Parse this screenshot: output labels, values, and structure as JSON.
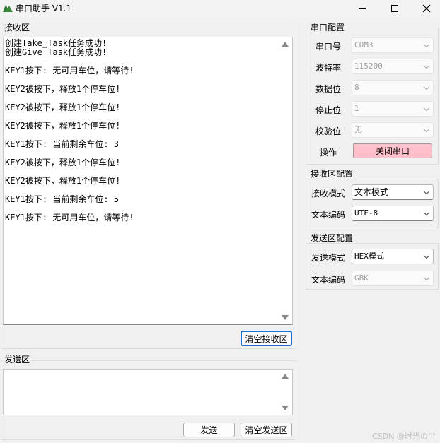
{
  "window": {
    "title": "串口助手 V1.1"
  },
  "receive": {
    "group_title": "接收区",
    "lines": [
      "创建Take_Task任务成功!",
      "创建Give_Task任务成功!",
      "",
      "KEY1按下: 无可用车位，请等待!",
      "",
      "KEY2被按下，释放1个停车位!",
      "",
      "KEY2被按下，释放1个停车位!",
      "",
      "KEY2被按下，释放1个停车位!",
      "",
      "KEY1按下: 当前剩余车位: 3",
      "",
      "KEY2被按下，释放1个停车位!",
      "",
      "KEY2被按下，释放1个停车位!",
      "",
      "KEY1按下: 当前剩余车位: 5",
      "",
      "KEY1按下: 无可用车位，请等待!"
    ],
    "clear_button": "清空接收区"
  },
  "send": {
    "group_title": "发送区",
    "send_button": "发送",
    "clear_button": "清空发送区"
  },
  "serial_config": {
    "group_title": "串口配置",
    "port_label": "串口号",
    "port_value": "COM3",
    "baud_label": "波特率",
    "baud_value": "115200",
    "databits_label": "数据位",
    "databits_value": "8",
    "stopbits_label": "停止位",
    "stopbits_value": "1",
    "parity_label": "校验位",
    "parity_value": "无",
    "operation_label": "操作",
    "operation_button": "关闭串口",
    "operation_button_color": "#ffc0cb"
  },
  "receive_config": {
    "group_title": "接收区配置",
    "mode_label": "接收模式",
    "mode_value": "文本模式",
    "encoding_label": "文本编码",
    "encoding_value": "UTF-8"
  },
  "send_config": {
    "group_title": "发送区配置",
    "mode_label": "发送模式",
    "mode_value": "HEX模式",
    "encoding_label": "文本编码",
    "encoding_value": "GBK"
  },
  "watermark": "CSDN @时光の尘"
}
